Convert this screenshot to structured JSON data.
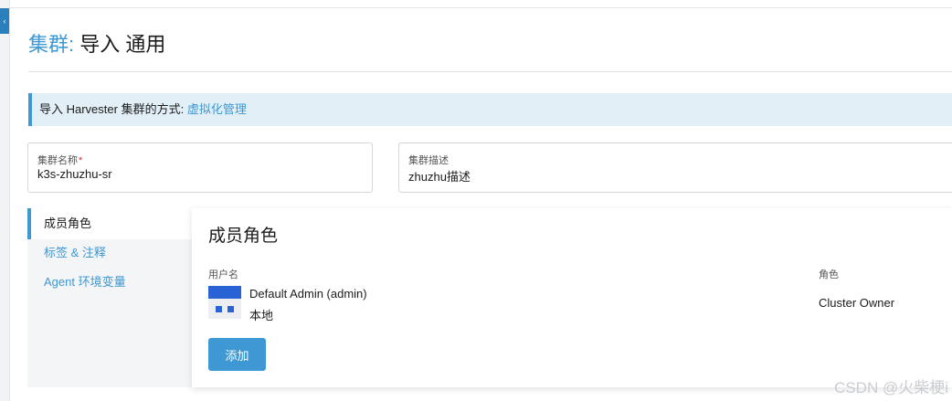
{
  "header": {
    "title_prefix": "集群:",
    "title_rest": " 导入 通用"
  },
  "banner": {
    "text": "导入 Harvester 集群的方式:",
    "link": "虚拟化管理"
  },
  "form": {
    "cluster_name": {
      "label": "集群名称",
      "required_mark": "*",
      "value": "k3s-zhuzhu-sr"
    },
    "description": {
      "label": "集群描述",
      "value": "zhuzhu描述"
    }
  },
  "side_nav": {
    "items": [
      {
        "label": "成员角色",
        "active": true
      },
      {
        "label": "标签 & 注释",
        "active": false
      },
      {
        "label": "Agent 环境变量",
        "active": false
      }
    ]
  },
  "members": {
    "title": "成员角色",
    "columns": {
      "user": "用户名",
      "role": "角色"
    },
    "rows": [
      {
        "name": "Default Admin (admin)",
        "source": "本地",
        "role": "Cluster Owner"
      }
    ],
    "add_label": "添加"
  },
  "watermark": "CSDN @火柴梗i",
  "icons": {
    "avatar": "avatar-icon",
    "collapse": "collapse-tab-icon"
  },
  "colors": {
    "accent": "#3d98d3",
    "avatar": "#2962d4",
    "banner_bg": "#e2eff7"
  }
}
